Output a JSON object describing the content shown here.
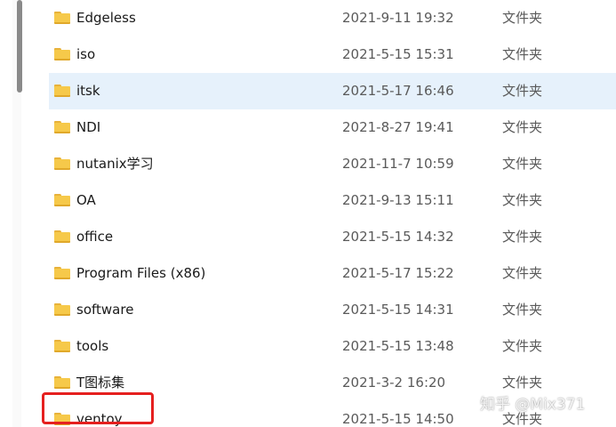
{
  "files": [
    {
      "name": "Edgeless",
      "date": "2021-9-11 19:32",
      "type": "文件夹",
      "icon": "folder-icon"
    },
    {
      "name": "iso",
      "date": "2021-5-15 15:31",
      "type": "文件夹",
      "icon": "folder-icon"
    },
    {
      "name": "itsk",
      "date": "2021-5-17 16:46",
      "type": "文件夹",
      "icon": "folder-icon",
      "selected": true
    },
    {
      "name": "NDI",
      "date": "2021-8-27 19:41",
      "type": "文件夹",
      "icon": "folder-icon"
    },
    {
      "name": "nutanix学习",
      "date": "2021-11-7 10:59",
      "type": "文件夹",
      "icon": "folder-icon"
    },
    {
      "name": "OA",
      "date": "2021-9-13 15:11",
      "type": "文件夹",
      "icon": "folder-icon"
    },
    {
      "name": "office",
      "date": "2021-5-15 14:32",
      "type": "文件夹",
      "icon": "folder-icon"
    },
    {
      "name": "Program Files (x86)",
      "date": "2021-5-17 15:22",
      "type": "文件夹",
      "icon": "folder-icon"
    },
    {
      "name": "software",
      "date": "2021-5-15 14:31",
      "type": "文件夹",
      "icon": "folder-icon"
    },
    {
      "name": "tools",
      "date": "2021-5-15 13:48",
      "type": "文件夹",
      "icon": "folder-icon"
    },
    {
      "name": "T图标集",
      "date": "2021-3-2 16:20",
      "type": "文件夹",
      "icon": "folder-icon"
    },
    {
      "name": "ventoy",
      "date": "2021-5-15 14:50",
      "type": "文件夹",
      "icon": "folder-icon",
      "highlighted": true
    }
  ],
  "watermark": "知乎 @Mix371",
  "colors": {
    "selected_row": "#e6f1fb",
    "highlight_border": "#e5201f",
    "folder": "#f6c94a"
  }
}
